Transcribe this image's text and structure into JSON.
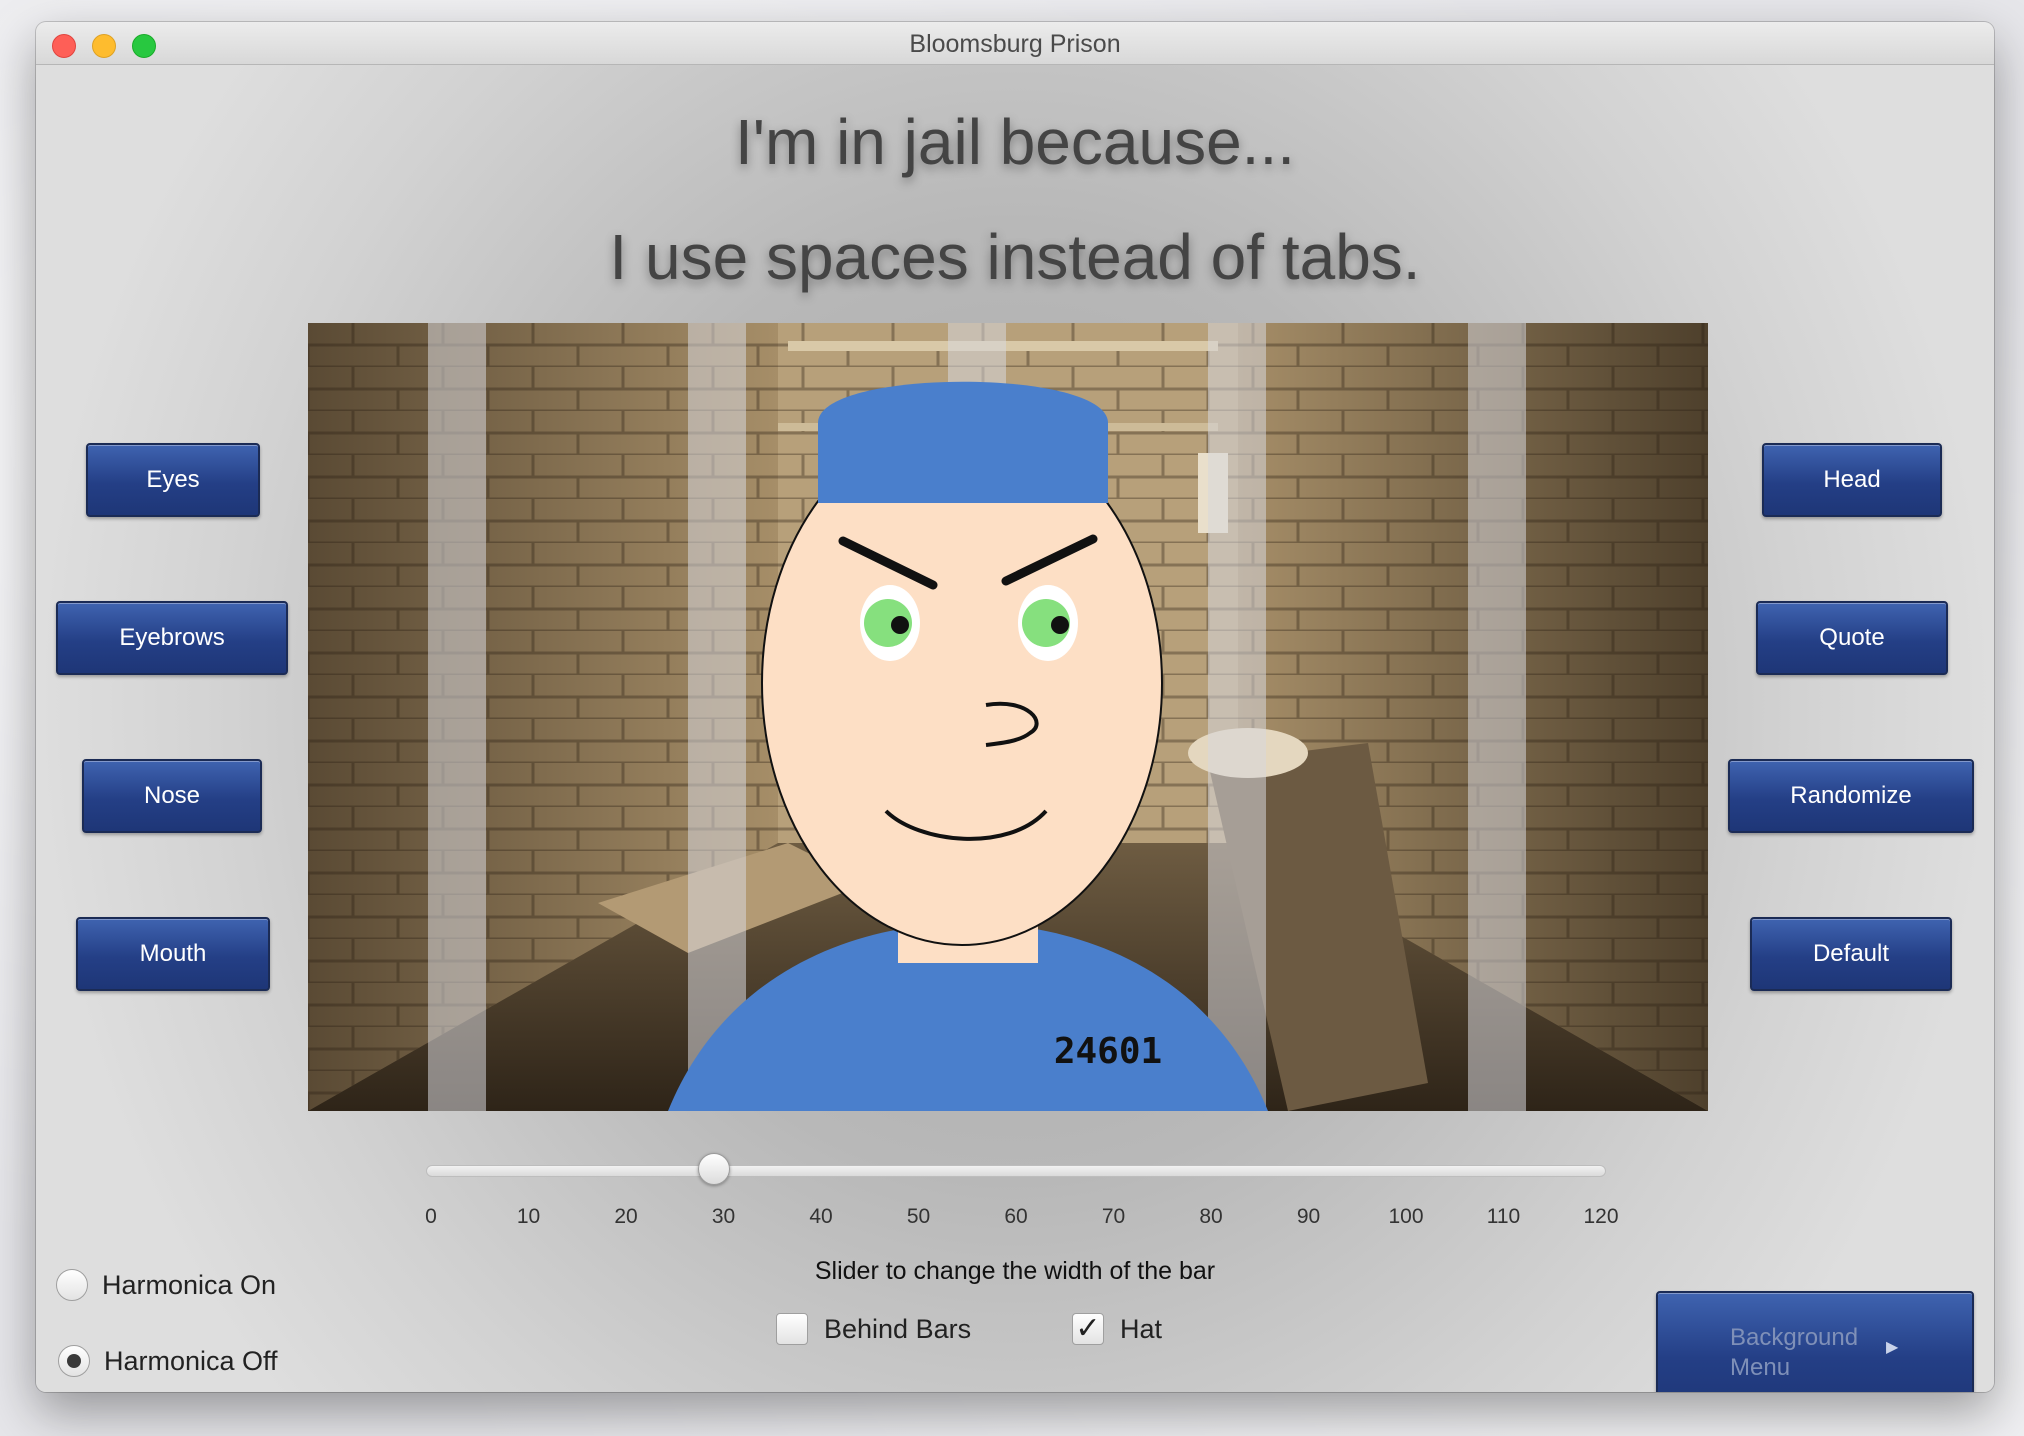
{
  "window": {
    "title": "Bloomsburg Prison"
  },
  "headline": {
    "line1": "I'm in jail because...",
    "line2": "I use spaces instead of tabs."
  },
  "left_buttons": [
    {
      "label": "Eyes"
    },
    {
      "label": "Eyebrows"
    },
    {
      "label": "Nose"
    },
    {
      "label": "Mouth"
    }
  ],
  "right_buttons": [
    {
      "label": "Head"
    },
    {
      "label": "Quote"
    },
    {
      "label": "Randomize"
    },
    {
      "label": "Default"
    }
  ],
  "prisoner": {
    "number": "24601",
    "hat_color": "#4a7fcc",
    "skin_color": "#fddfc5",
    "eye_color": "#86e07e"
  },
  "slider": {
    "value": 29,
    "min": 0,
    "max": 120,
    "ticks": [
      "0",
      "10",
      "20",
      "30",
      "40",
      "50",
      "60",
      "70",
      "80",
      "90",
      "100",
      "110",
      "120"
    ],
    "caption": "Slider to change the width of the bar"
  },
  "harmonica": {
    "on_label": "Harmonica On",
    "off_label": "Harmonica Off",
    "selected": "off"
  },
  "options": {
    "behind_bars_label": "Behind Bars",
    "behind_bars_checked": false,
    "hat_label": "Hat",
    "hat_checked": true
  },
  "menu_button": {
    "label": "Background Menu"
  }
}
